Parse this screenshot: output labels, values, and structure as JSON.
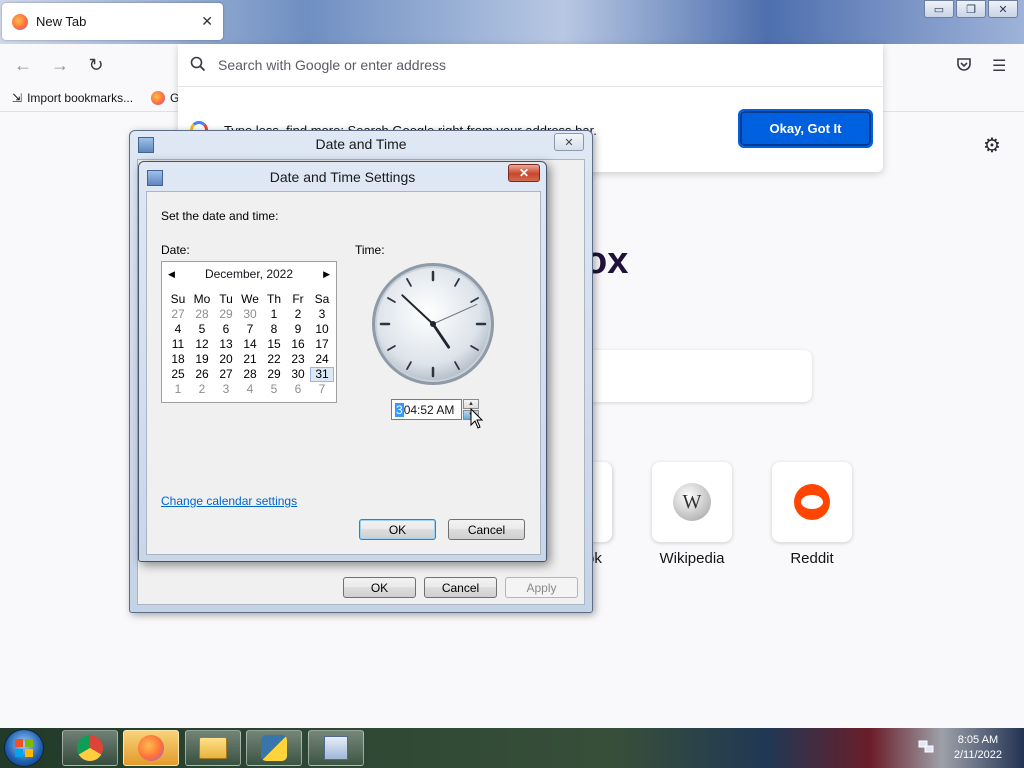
{
  "browser": {
    "tab_title": "New Tab",
    "address_placeholder": "Search with Google or enter address",
    "bookmark_import": "Import bookmarks...",
    "bookmark_next": "G",
    "tip_text": "Type less, find more: Search Google right from your address bar.",
    "tip_button": "Okay, Got It",
    "brand_partial": "ox",
    "shortcuts": [
      {
        "label": "ok"
      },
      {
        "label": "Wikipedia"
      },
      {
        "label": "Reddit"
      }
    ]
  },
  "outer_dialog": {
    "title": "Date and Time",
    "close": "✕",
    "ok": "OK",
    "cancel": "Cancel",
    "apply": "Apply"
  },
  "inner_dialog": {
    "title": "Date and Time Settings",
    "close": "✕",
    "instruction": "Set the date and time:",
    "date_label": "Date:",
    "time_label": "Time:",
    "calendar": {
      "month_year": "December, 2022",
      "prev": "◀",
      "next": "▶",
      "day_names": [
        "Su",
        "Mo",
        "Tu",
        "We",
        "Th",
        "Fr",
        "Sa"
      ],
      "weeks": [
        [
          {
            "d": "27",
            "m": true
          },
          {
            "d": "28",
            "m": true
          },
          {
            "d": "29",
            "m": true
          },
          {
            "d": "30",
            "m": true
          },
          {
            "d": "1"
          },
          {
            "d": "2"
          },
          {
            "d": "3"
          }
        ],
        [
          {
            "d": "4"
          },
          {
            "d": "5"
          },
          {
            "d": "6"
          },
          {
            "d": "7"
          },
          {
            "d": "8"
          },
          {
            "d": "9"
          },
          {
            "d": "10"
          }
        ],
        [
          {
            "d": "11"
          },
          {
            "d": "12"
          },
          {
            "d": "13"
          },
          {
            "d": "14"
          },
          {
            "d": "15"
          },
          {
            "d": "16"
          },
          {
            "d": "17"
          }
        ],
        [
          {
            "d": "18"
          },
          {
            "d": "19"
          },
          {
            "d": "20"
          },
          {
            "d": "21"
          },
          {
            "d": "22"
          },
          {
            "d": "23"
          },
          {
            "d": "24"
          }
        ],
        [
          {
            "d": "25"
          },
          {
            "d": "26"
          },
          {
            "d": "27"
          },
          {
            "d": "28"
          },
          {
            "d": "29"
          },
          {
            "d": "30"
          },
          {
            "d": "31",
            "s": true
          }
        ],
        [
          {
            "d": "1",
            "m": true
          },
          {
            "d": "2",
            "m": true
          },
          {
            "d": "3",
            "m": true
          },
          {
            "d": "4",
            "m": true
          },
          {
            "d": "5",
            "m": true
          },
          {
            "d": "6",
            "m": true
          },
          {
            "d": "7",
            "m": true
          }
        ]
      ]
    },
    "clock": {
      "hour": 4,
      "minute": 52,
      "second": 11
    },
    "time_selected": "3",
    "time_rest": "04:52 AM",
    "change_calendar_link": "Change calendar settings",
    "ok": "OK",
    "cancel": "Cancel"
  },
  "taskbar": {
    "time": "8:05 AM",
    "date": "2/11/2022"
  },
  "window_controls": {
    "minimize": "▭",
    "restore": "❐",
    "close": "✕"
  }
}
